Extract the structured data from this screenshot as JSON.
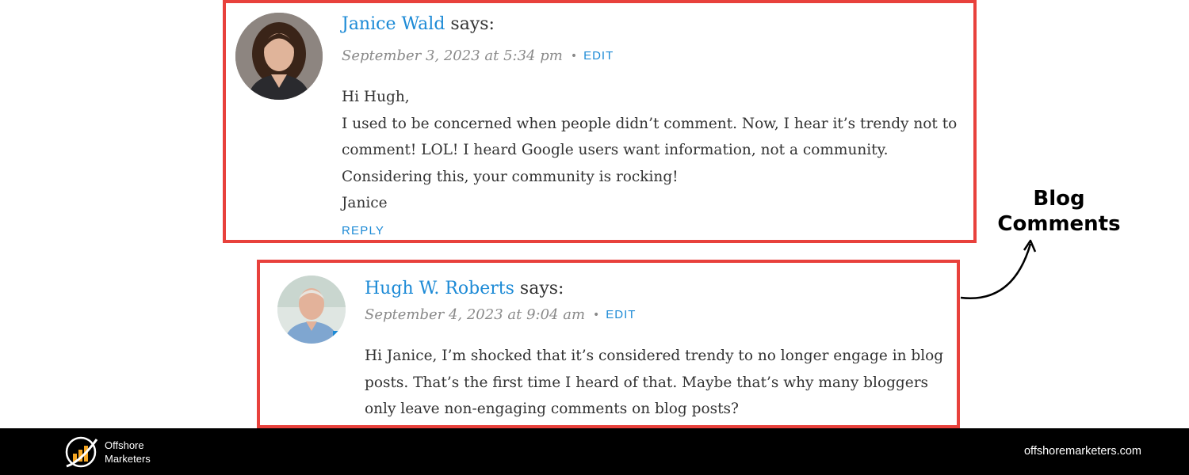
{
  "comments": [
    {
      "author": "Janice Wald",
      "says": " says:",
      "date": "September 3, 2023 at 5:34 pm",
      "edit_label": "EDIT",
      "paragraphs": [
        "Hi Hugh,",
        "I used to be concerned when people didn’t comment. Now, I hear it’s trendy not to comment! LOL! I heard Google users want information, not a community. Considering this, your community is rocking!",
        "Janice"
      ],
      "reply_label": "REPLY"
    },
    {
      "author": "Hugh W. Roberts",
      "says": " says:",
      "date": "September 4, 2023 at 9:04 am",
      "edit_label": "EDIT",
      "paragraphs": [
        "Hi Janice, I’m shocked that it’s considered trendy to no longer engage in blog posts. That’s the first time I heard of that. Maybe that’s why many bloggers only leave non-engaging comments on blog posts?"
      ]
    }
  ],
  "callout": {
    "line1": "Blog",
    "line2": "Comments"
  },
  "footer": {
    "logo_line1": "Offshore",
    "logo_line2": "Marketers",
    "site_url": "offshoremarketers.com"
  },
  "colors": {
    "highlight_border": "#e8413c",
    "link_blue": "#1c8ad6",
    "footer_bg": "#000000"
  }
}
